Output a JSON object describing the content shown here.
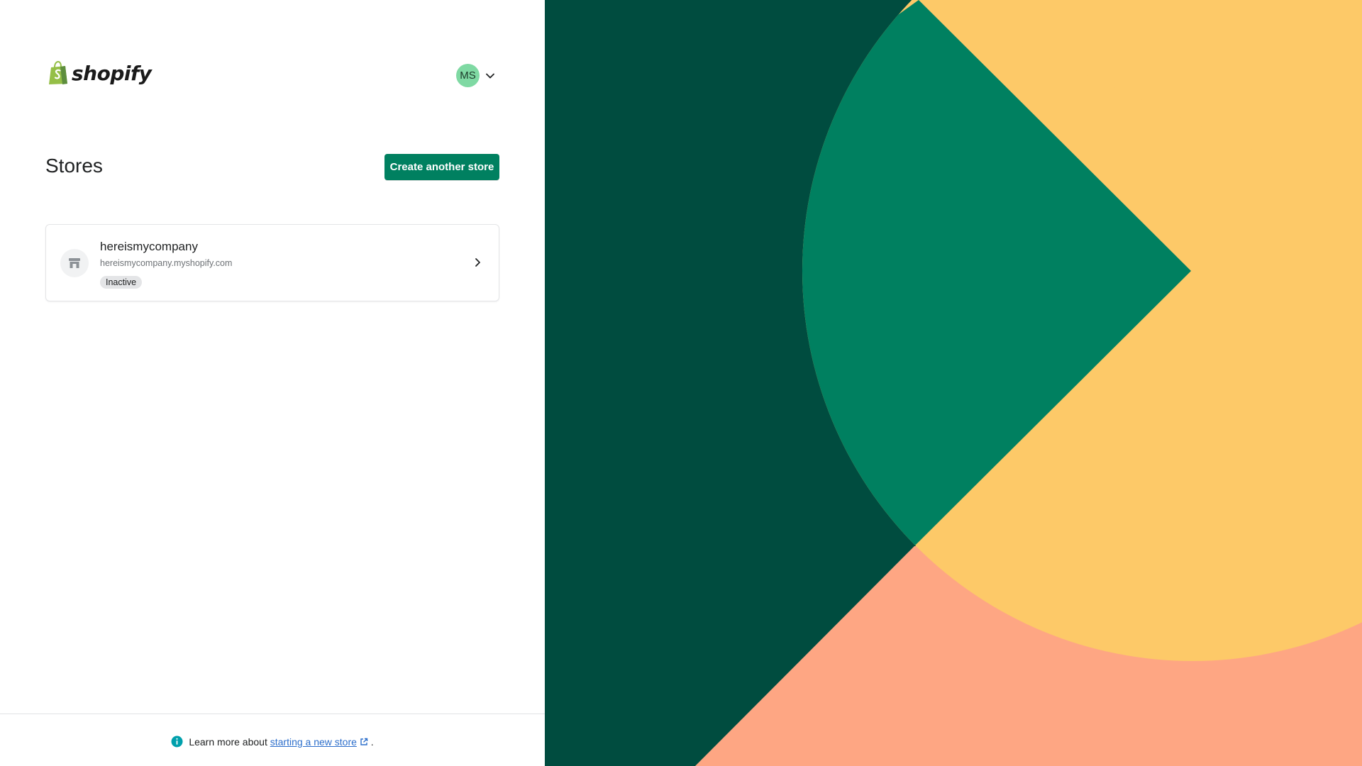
{
  "brand": {
    "logo_text": "shopify",
    "logo_color": "#95bf47"
  },
  "account": {
    "initials": "MS",
    "avatar_color": "#7fd9a3"
  },
  "page": {
    "title": "Stores",
    "create_button": "Create another store",
    "accent": "#008060"
  },
  "stores": [
    {
      "name": "hereismycompany",
      "url": "hereismycompany.myshopify.com",
      "status": "Inactive"
    }
  ],
  "footer": {
    "prefix": "Learn more about",
    "link_text": "starting a new store",
    "suffix": "."
  },
  "illustration": {
    "colors": [
      "#004c3f",
      "#008060",
      "#fdc968",
      "#fea683"
    ]
  }
}
